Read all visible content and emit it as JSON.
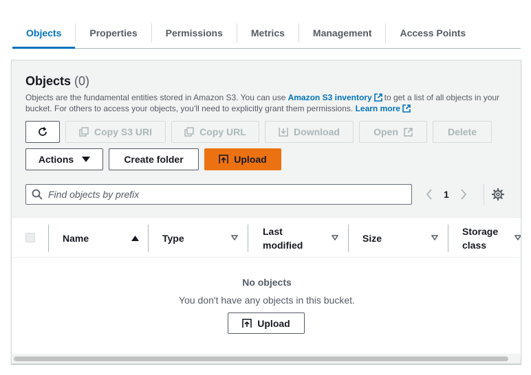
{
  "tabs": [
    {
      "label": "Objects",
      "active": true
    },
    {
      "label": "Properties",
      "active": false
    },
    {
      "label": "Permissions",
      "active": false
    },
    {
      "label": "Metrics",
      "active": false
    },
    {
      "label": "Management",
      "active": false
    },
    {
      "label": "Access Points",
      "active": false
    }
  ],
  "objects_panel": {
    "title": "Objects",
    "count": "(0)",
    "description_part1": "Objects are the fundamental entities stored in Amazon S3. You can use",
    "inventory_link": "Amazon S3 inventory",
    "description_part2": "to get a list of all objects in your bucket. For others to access your objects, you’ll need to explicitly grant them permissions.",
    "learn_more_link": "Learn more"
  },
  "toolbar": {
    "refresh_icon": "refresh-icon",
    "copy_uri_label": "Copy S3 URI",
    "copy_url_label": "Copy URL",
    "download_label": "Download",
    "open_label": "Open",
    "delete_label": "Delete",
    "actions_label": "Actions",
    "create_folder_label": "Create folder",
    "upload_label": "Upload"
  },
  "search": {
    "placeholder": "Find objects by prefix",
    "value": ""
  },
  "pagination": {
    "current_page": "1"
  },
  "table": {
    "columns": [
      {
        "label": "Name",
        "sort": "ascending"
      },
      {
        "label": "Type",
        "sort": "none"
      },
      {
        "label": "Last modified",
        "sort": "none"
      },
      {
        "label": "Size",
        "sort": "none"
      },
      {
        "label": "Storage class",
        "sort": "none"
      }
    ],
    "rows": [],
    "empty_title": "No objects",
    "empty_message": "You don't have any objects in this bucket.",
    "empty_upload_label": "Upload"
  },
  "colors": {
    "accent": "#0073bb",
    "primary_button": "#ec7211",
    "disabled_text": "#aab7b8"
  }
}
